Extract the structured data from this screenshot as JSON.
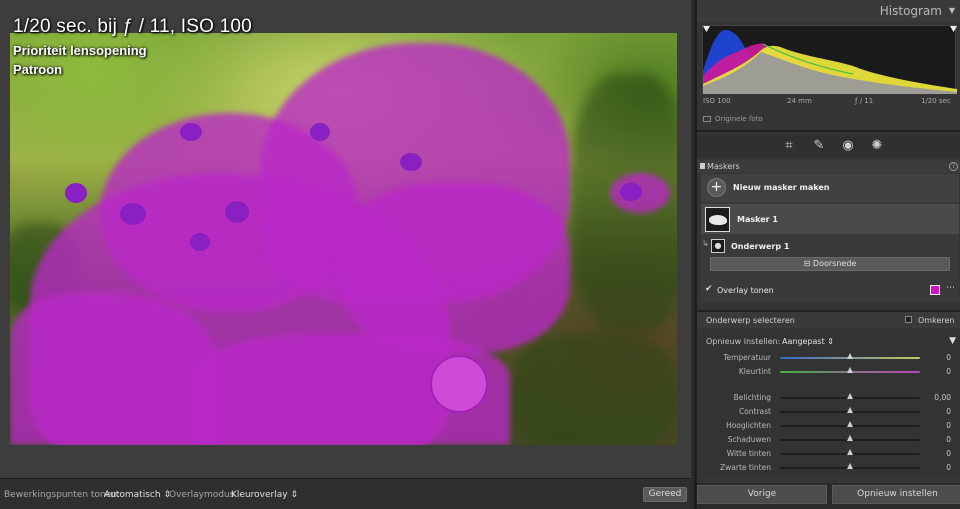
{
  "photo_info": {
    "title": "1/20 sec. bij ƒ / 11, ISO 100",
    "mode": "Prioriteit lensopening",
    "pattern": "Patroon"
  },
  "toolbar": {
    "edit_points_label": "Bewerkingspunten tonen:",
    "edit_points_value": "Automatisch",
    "overlay_mode_label": "Overlaymodus",
    "overlay_mode_value": "Kleuroverlay",
    "done_label": "Gereed"
  },
  "histogram": {
    "title": "Histogram",
    "iso": "ISO 100",
    "focal": "24 mm",
    "aperture": "ƒ / 11",
    "shutter": "1/20 sec",
    "original_label": "Originele foto"
  },
  "masks": {
    "header": "Maskers",
    "new_mask_label": "Nieuw masker maken",
    "mask1_label": "Masker 1",
    "subject_label": "Onderwerp 1",
    "intersect_label": "Doorsnede",
    "overlay_label": "Overlay tonen",
    "overlay_color": "#d312c8"
  },
  "select_subject": {
    "label": "Onderwerp selecteren",
    "invert_label": "Omkeren"
  },
  "adjustments": {
    "reset_label": "Opnieuw instellen:",
    "preset_value": "Aangepast",
    "sliders": [
      {
        "label": "Temperatuur",
        "value": "0",
        "pos": 0.5,
        "track": "temp"
      },
      {
        "label": "Kleurtint",
        "value": "0",
        "pos": 0.5,
        "track": "tint"
      },
      {
        "label": "Belichting",
        "value": "0,00",
        "pos": 0.5,
        "track": "gray"
      },
      {
        "label": "Contrast",
        "value": "0",
        "pos": 0.5,
        "track": "gray"
      },
      {
        "label": "Hooglichten",
        "value": "0",
        "pos": 0.5,
        "track": "gray"
      },
      {
        "label": "Schaduwen",
        "value": "0",
        "pos": 0.5,
        "track": "gray"
      },
      {
        "label": "Witte tinten",
        "value": "0",
        "pos": 0.5,
        "track": "gray"
      },
      {
        "label": "Zwarte tinten",
        "value": "0",
        "pos": 0.5,
        "track": "gray"
      }
    ]
  },
  "panel_buttons": {
    "previous_label": "Vorige",
    "reset_label": "Opnieuw instellen"
  }
}
